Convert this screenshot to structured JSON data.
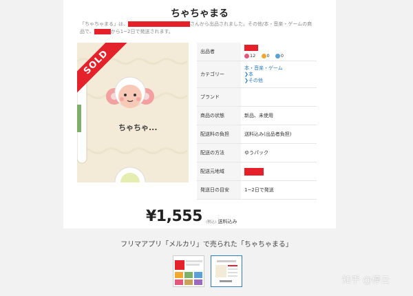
{
  "title": "ちゃちゃまる",
  "description": {
    "part1": "「ちゃちゃまる」は、",
    "part2": "さんから出品されました。その他/本・音楽・ゲームの商品で、",
    "part3": "から1~2日で発送されます。"
  },
  "image": {
    "sold_badge": "SOLD",
    "character_label": "ちゃちゃ..."
  },
  "info": {
    "seller_label": "出品者",
    "ratings": {
      "good": "12",
      "normal": "0",
      "bad": "0"
    },
    "category_label": "カテゴリー",
    "category": [
      "本・音楽・ゲーム",
      "本",
      "その他"
    ],
    "brand_label": "ブランド",
    "condition_label": "商品の状態",
    "condition": "新品、未使用",
    "shipping_fee_label": "配送料の負担",
    "shipping_fee": "送料込み(出品者負担)",
    "shipping_method_label": "配送の方法",
    "shipping_method": "ゆうパック",
    "ship_from_label": "配送元地域",
    "ship_days_label": "発送日の目安",
    "ship_days": "1~2日で発送"
  },
  "price": {
    "amount": "¥1,555",
    "tax": "(税込)",
    "shipping": "送料込み"
  },
  "caption": "フリマアプリ「メルカリ」で売られた「ちゃちゃまる」",
  "watermark": "知乎 @停云",
  "colors": {
    "accent": "#e4222c",
    "link": "#2b7bbd"
  }
}
